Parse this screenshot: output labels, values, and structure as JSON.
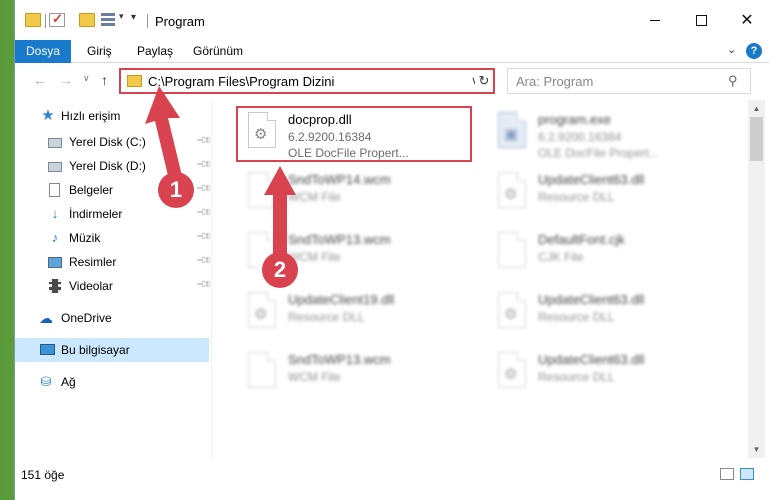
{
  "window": {
    "title": "Program"
  },
  "ribbon": {
    "tabs": [
      "Dosya",
      "Giriş",
      "Paylaş",
      "Görünüm"
    ],
    "help": "?"
  },
  "nav": {
    "address": "C:\\Program Files\\Program Dizini",
    "search_placeholder": "Ara: Program"
  },
  "sidebar": {
    "items": [
      {
        "label": "Hızlı erişim",
        "icon": "star-icon"
      },
      {
        "label": "Yerel Disk (C:)",
        "icon": "drive-icon",
        "pinned": true
      },
      {
        "label": "Yerel Disk (D:)",
        "icon": "drive-icon",
        "pinned": true
      },
      {
        "label": "Belgeler",
        "icon": "document-icon",
        "pinned": true
      },
      {
        "label": "İndirmeler",
        "icon": "download-icon",
        "pinned": true
      },
      {
        "label": "Müzik",
        "icon": "music-icon",
        "pinned": true
      },
      {
        "label": "Resimler",
        "icon": "picture-icon",
        "pinned": true
      },
      {
        "label": "Videolar",
        "icon": "video-icon",
        "pinned": true
      },
      {
        "label": "OneDrive",
        "icon": "cloud-icon"
      },
      {
        "label": "Bu bilgisayar",
        "icon": "computer-icon",
        "selected": true
      },
      {
        "label": "Ağ",
        "icon": "network-icon"
      }
    ]
  },
  "files": [
    {
      "name": "docprop.dll",
      "line1": "6.2.9200.16384",
      "line2": "OLE DocFile Propert...",
      "highlight": true
    },
    {
      "name": "program.exe",
      "line1": "6.2.9200.16384",
      "line2": "OLE DocFile Propert...",
      "blurred": true
    },
    {
      "name": "SndToWP14.wcm",
      "line1": "WCM File",
      "blurred": true
    },
    {
      "name": "UpdateClient63.dll",
      "line1": "Resource DLL",
      "blurred": true
    },
    {
      "name": "SndToWP13.wcm",
      "line1": "WCM File",
      "blurred": true
    },
    {
      "name": "DefaultFont.cjk",
      "line1": "CJK File",
      "blurred": true
    },
    {
      "name": "UpdateClient19.dll",
      "line1": "Resource DLL",
      "blurred": true
    },
    {
      "name": "UpdateClient63.dll",
      "line1": "Resource DLL",
      "blurred": true
    },
    {
      "name": "SndToWP13.wcm",
      "line1": "WCM File",
      "blurred": true
    },
    {
      "name": "UpdateClient63.dll",
      "line1": "Resource DLL",
      "blurred": true
    }
  ],
  "status": {
    "count": "151 öğe"
  },
  "annotations": {
    "badge1": "1",
    "badge2": "2"
  },
  "colors": {
    "accent": "#1979ca",
    "highlight": "#d94350",
    "selection": "#cce8ff"
  }
}
